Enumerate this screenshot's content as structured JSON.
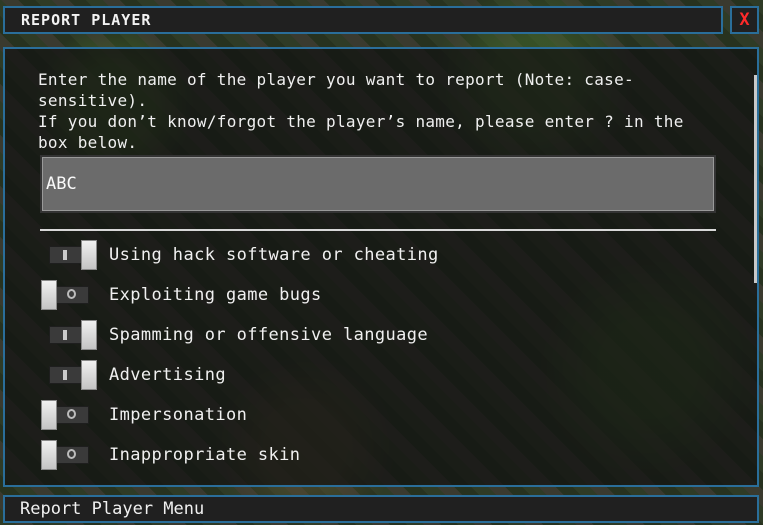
{
  "window": {
    "title": "REPORT PLAYER",
    "close_label": "X"
  },
  "instructions": {
    "line1": "Enter the name of the player you want to report (Note: case-sensitive).",
    "line2": "If you don’t know/forgot the player’s name, please enter ? in the box below."
  },
  "name_input": {
    "value": "ABC"
  },
  "options": [
    {
      "label": "Using hack software or cheating",
      "enabled": true
    },
    {
      "label": "Exploiting game bugs",
      "enabled": false
    },
    {
      "label": "Spamming or offensive language",
      "enabled": true
    },
    {
      "label": "Advertising",
      "enabled": true
    },
    {
      "label": "Impersonation",
      "enabled": false
    },
    {
      "label": "Inappropriate skin",
      "enabled": false
    }
  ],
  "footer": {
    "label": "Report Player Menu"
  },
  "colors": {
    "border": "#2a6e9a",
    "close_x": "#ff2a2a",
    "input_bg": "#6b6b6b"
  }
}
